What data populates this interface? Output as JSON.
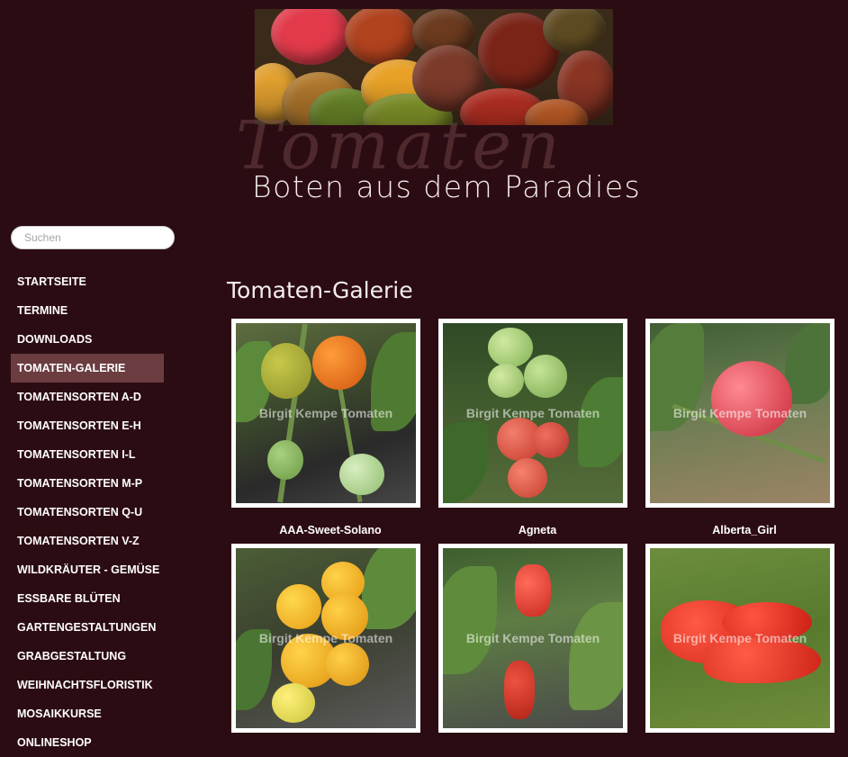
{
  "header": {
    "logo_script": "Tomaten",
    "logo_subtitle": "Boten aus dem Paradies"
  },
  "search": {
    "placeholder": "Suchen"
  },
  "nav": {
    "items": [
      {
        "label": "STARTSEITE"
      },
      {
        "label": "TERMINE"
      },
      {
        "label": "DOWNLOADS"
      },
      {
        "label": "TOMATEN-GALERIE",
        "active": true
      },
      {
        "label": "TOMATENSORTEN A-D"
      },
      {
        "label": "TOMATENSORTEN E-H"
      },
      {
        "label": "TOMATENSORTEN I-L"
      },
      {
        "label": "TOMATENSORTEN M-P"
      },
      {
        "label": "TOMATENSORTEN Q-U"
      },
      {
        "label": "TOMATENSORTEN V-Z"
      },
      {
        "label": "WILDKRÄUTER - GEMÜSE"
      },
      {
        "label": "ESSBARE BLÜTEN"
      },
      {
        "label": "GARTENGESTALTUNGEN"
      },
      {
        "label": "GRABGESTALTUNG"
      },
      {
        "label": "WEIHNACHTSFLORISTIK"
      },
      {
        "label": "MOSAIKKURSE"
      },
      {
        "label": "ONLINESHOP"
      }
    ]
  },
  "main": {
    "title": "Tomaten-Galerie",
    "watermark": "Birgit Kempe Tomaten",
    "gallery": [
      {
        "caption": "AAA-Sweet-Solano"
      },
      {
        "caption": "Agneta"
      },
      {
        "caption": "Alberta_Girl"
      },
      {
        "caption": ""
      },
      {
        "caption": ""
      },
      {
        "caption": ""
      }
    ]
  },
  "colors": {
    "background": "#2c0c13",
    "nav_active": "#6b3d40",
    "text": "#ffffff"
  }
}
